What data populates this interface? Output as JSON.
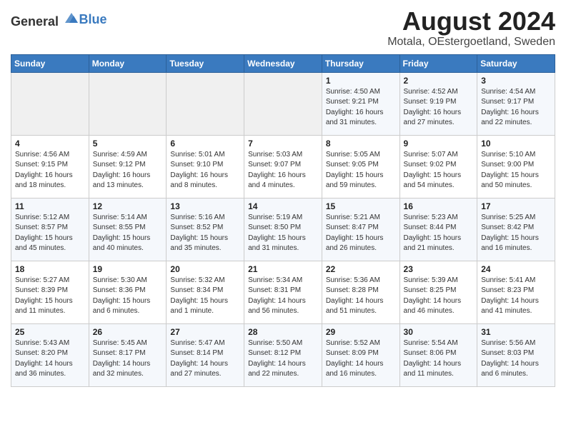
{
  "header": {
    "logo_general": "General",
    "logo_blue": "Blue",
    "main_title": "August 2024",
    "subtitle": "Motala, OEstergoetland, Sweden"
  },
  "days_of_week": [
    "Sunday",
    "Monday",
    "Tuesday",
    "Wednesday",
    "Thursday",
    "Friday",
    "Saturday"
  ],
  "weeks": [
    [
      {
        "day": "",
        "info": ""
      },
      {
        "day": "",
        "info": ""
      },
      {
        "day": "",
        "info": ""
      },
      {
        "day": "",
        "info": ""
      },
      {
        "day": "1",
        "info": "Sunrise: 4:50 AM\nSunset: 9:21 PM\nDaylight: 16 hours\nand 31 minutes."
      },
      {
        "day": "2",
        "info": "Sunrise: 4:52 AM\nSunset: 9:19 PM\nDaylight: 16 hours\nand 27 minutes."
      },
      {
        "day": "3",
        "info": "Sunrise: 4:54 AM\nSunset: 9:17 PM\nDaylight: 16 hours\nand 22 minutes."
      }
    ],
    [
      {
        "day": "4",
        "info": "Sunrise: 4:56 AM\nSunset: 9:15 PM\nDaylight: 16 hours\nand 18 minutes."
      },
      {
        "day": "5",
        "info": "Sunrise: 4:59 AM\nSunset: 9:12 PM\nDaylight: 16 hours\nand 13 minutes."
      },
      {
        "day": "6",
        "info": "Sunrise: 5:01 AM\nSunset: 9:10 PM\nDaylight: 16 hours\nand 8 minutes."
      },
      {
        "day": "7",
        "info": "Sunrise: 5:03 AM\nSunset: 9:07 PM\nDaylight: 16 hours\nand 4 minutes."
      },
      {
        "day": "8",
        "info": "Sunrise: 5:05 AM\nSunset: 9:05 PM\nDaylight: 15 hours\nand 59 minutes."
      },
      {
        "day": "9",
        "info": "Sunrise: 5:07 AM\nSunset: 9:02 PM\nDaylight: 15 hours\nand 54 minutes."
      },
      {
        "day": "10",
        "info": "Sunrise: 5:10 AM\nSunset: 9:00 PM\nDaylight: 15 hours\nand 50 minutes."
      }
    ],
    [
      {
        "day": "11",
        "info": "Sunrise: 5:12 AM\nSunset: 8:57 PM\nDaylight: 15 hours\nand 45 minutes."
      },
      {
        "day": "12",
        "info": "Sunrise: 5:14 AM\nSunset: 8:55 PM\nDaylight: 15 hours\nand 40 minutes."
      },
      {
        "day": "13",
        "info": "Sunrise: 5:16 AM\nSunset: 8:52 PM\nDaylight: 15 hours\nand 35 minutes."
      },
      {
        "day": "14",
        "info": "Sunrise: 5:19 AM\nSunset: 8:50 PM\nDaylight: 15 hours\nand 31 minutes."
      },
      {
        "day": "15",
        "info": "Sunrise: 5:21 AM\nSunset: 8:47 PM\nDaylight: 15 hours\nand 26 minutes."
      },
      {
        "day": "16",
        "info": "Sunrise: 5:23 AM\nSunset: 8:44 PM\nDaylight: 15 hours\nand 21 minutes."
      },
      {
        "day": "17",
        "info": "Sunrise: 5:25 AM\nSunset: 8:42 PM\nDaylight: 15 hours\nand 16 minutes."
      }
    ],
    [
      {
        "day": "18",
        "info": "Sunrise: 5:27 AM\nSunset: 8:39 PM\nDaylight: 15 hours\nand 11 minutes."
      },
      {
        "day": "19",
        "info": "Sunrise: 5:30 AM\nSunset: 8:36 PM\nDaylight: 15 hours\nand 6 minutes."
      },
      {
        "day": "20",
        "info": "Sunrise: 5:32 AM\nSunset: 8:34 PM\nDaylight: 15 hours\nand 1 minute."
      },
      {
        "day": "21",
        "info": "Sunrise: 5:34 AM\nSunset: 8:31 PM\nDaylight: 14 hours\nand 56 minutes."
      },
      {
        "day": "22",
        "info": "Sunrise: 5:36 AM\nSunset: 8:28 PM\nDaylight: 14 hours\nand 51 minutes."
      },
      {
        "day": "23",
        "info": "Sunrise: 5:39 AM\nSunset: 8:25 PM\nDaylight: 14 hours\nand 46 minutes."
      },
      {
        "day": "24",
        "info": "Sunrise: 5:41 AM\nSunset: 8:23 PM\nDaylight: 14 hours\nand 41 minutes."
      }
    ],
    [
      {
        "day": "25",
        "info": "Sunrise: 5:43 AM\nSunset: 8:20 PM\nDaylight: 14 hours\nand 36 minutes."
      },
      {
        "day": "26",
        "info": "Sunrise: 5:45 AM\nSunset: 8:17 PM\nDaylight: 14 hours\nand 32 minutes."
      },
      {
        "day": "27",
        "info": "Sunrise: 5:47 AM\nSunset: 8:14 PM\nDaylight: 14 hours\nand 27 minutes."
      },
      {
        "day": "28",
        "info": "Sunrise: 5:50 AM\nSunset: 8:12 PM\nDaylight: 14 hours\nand 22 minutes."
      },
      {
        "day": "29",
        "info": "Sunrise: 5:52 AM\nSunset: 8:09 PM\nDaylight: 14 hours\nand 16 minutes."
      },
      {
        "day": "30",
        "info": "Sunrise: 5:54 AM\nSunset: 8:06 PM\nDaylight: 14 hours\nand 11 minutes."
      },
      {
        "day": "31",
        "info": "Sunrise: 5:56 AM\nSunset: 8:03 PM\nDaylight: 14 hours\nand 6 minutes."
      }
    ]
  ]
}
